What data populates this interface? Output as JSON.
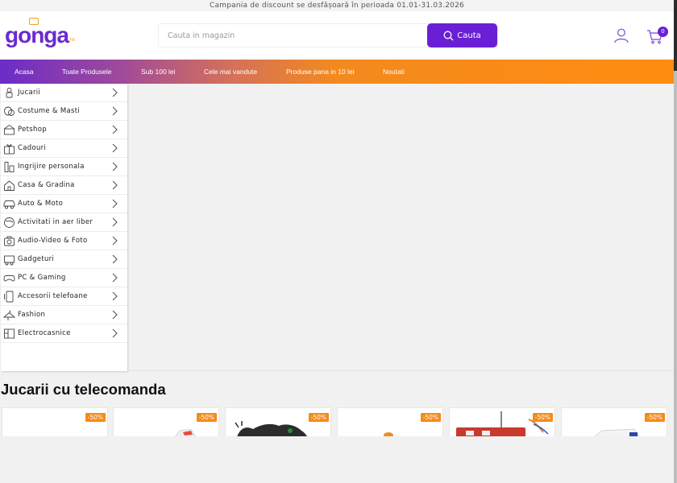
{
  "topbar": {
    "text": "Campania de discount se desfășoară în perioada 01.01-31.03.2026"
  },
  "header": {
    "logo": {
      "text": "gonga",
      "suffix": ".ro"
    },
    "search": {
      "placeholder": "Cauta in magazin",
      "button_label": "Cauta"
    },
    "cart_count": "0"
  },
  "nav": {
    "items": [
      "Acasa",
      "Toate Produsele",
      "Sub 100 lei",
      "Cele mai vandute",
      "Produse pana in 10 lei",
      "Noutati"
    ]
  },
  "sidebar": {
    "categories": [
      {
        "label": "Jucarii",
        "icon": "toy-icon"
      },
      {
        "label": "Costume & Masti",
        "icon": "mask-icon"
      },
      {
        "label": "Petshop",
        "icon": "pet-icon"
      },
      {
        "label": "Cadouri",
        "icon": "gift-icon"
      },
      {
        "label": "Ingrijire personala",
        "icon": "personal-care-icon"
      },
      {
        "label": "Casa & Gradina",
        "icon": "home-garden-icon"
      },
      {
        "label": "Auto & Moto",
        "icon": "car-icon"
      },
      {
        "label": "Activitati in aer liber",
        "icon": "outdoor-icon"
      },
      {
        "label": "Audio-Video & Foto",
        "icon": "camera-icon"
      },
      {
        "label": "Gadgeturi",
        "icon": "gadget-icon"
      },
      {
        "label": "PC & Gaming",
        "icon": "gamepad-icon"
      },
      {
        "label": "Accesorii telefoane",
        "icon": "phone-icon"
      },
      {
        "label": "Fashion",
        "icon": "fashion-icon"
      },
      {
        "label": "Electrocasnice",
        "icon": "appliance-icon"
      }
    ]
  },
  "section": {
    "title": "Jucarii cu telecomanda"
  },
  "products": [
    {
      "discount": "-50%"
    },
    {
      "discount": "-50%"
    },
    {
      "discount": "-50%"
    },
    {
      "discount": "-50%"
    },
    {
      "discount": "-50%"
    },
    {
      "discount": "-50%"
    }
  ],
  "colors": {
    "brand_purple": "#6a1fd6",
    "accent_orange": "#f38b1c"
  }
}
